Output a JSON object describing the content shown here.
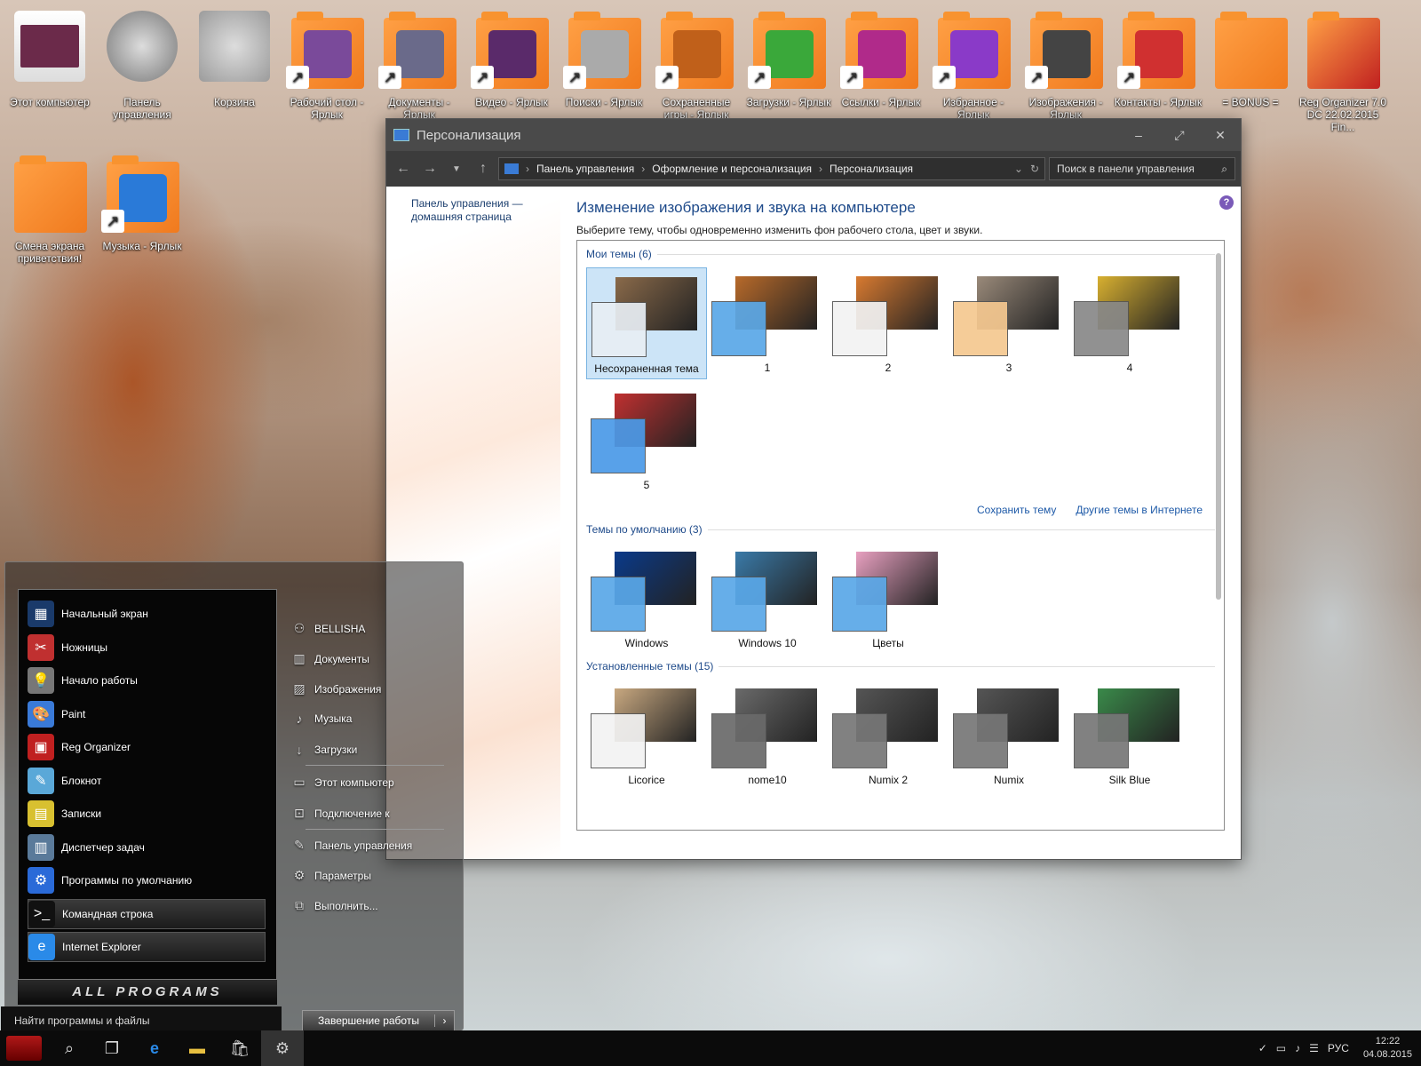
{
  "desktop_icons": [
    {
      "label": "Этот компьютер",
      "icon": "computer-icon",
      "color": "#6b2a4a"
    },
    {
      "label": "Панель управления",
      "icon": "gear-icon",
      "color": "#777777"
    },
    {
      "label": "Корзина",
      "icon": "recycle-bin-icon",
      "color": "#9b9b9b"
    },
    {
      "label": "Рабочий стол - Ярлык",
      "icon": "desktop-folder-icon",
      "color": "#7a4a9a"
    },
    {
      "label": "Документы - Ярлык",
      "icon": "documents-folder-icon",
      "color": "#6a6a8a"
    },
    {
      "label": "Видео - Ярлык",
      "icon": "video-folder-icon",
      "color": "#5a2a6a"
    },
    {
      "label": "Поиски - Ярлык",
      "icon": "search-folder-icon",
      "color": "#aaaaaa"
    },
    {
      "label": "Сохраненные игры - Ярлык",
      "icon": "games-folder-icon",
      "color": "#c0601a"
    },
    {
      "label": "Загрузки - Ярлык",
      "icon": "downloads-folder-icon",
      "color": "#3aa83a"
    },
    {
      "label": "Ссылки - Ярлык",
      "icon": "links-folder-icon",
      "color": "#b02a8a"
    },
    {
      "label": "Избранное - Ярлык",
      "icon": "favorites-folder-icon",
      "color": "#8a3ac8"
    },
    {
      "label": "Изображения - Ярлык",
      "icon": "pictures-folder-icon",
      "color": "#444444"
    },
    {
      "label": "Контакты - Ярлык",
      "icon": "contacts-folder-icon",
      "color": "#d03030"
    },
    {
      "label": "= BONUS =",
      "icon": "folder-icon",
      "color": "#f07a1e"
    },
    {
      "label": "Reg Organizer 7.0 DC 22.02.2015 Fin...",
      "icon": "folder-icon",
      "color": "#c02020"
    },
    {
      "label": "Смена экрана приветствия!",
      "icon": "folder-icon",
      "color": "#f07a1e"
    },
    {
      "label": "Музыка - Ярлык",
      "icon": "music-folder-icon",
      "color": "#2a7ad8"
    }
  ],
  "window": {
    "title": "Персонализация",
    "minimize": "–",
    "maximize": "⤢",
    "close": "✕",
    "breadcrumb": [
      "Панель управления",
      "Оформление и персонализация",
      "Персонализация"
    ],
    "search_placeholder": "Поиск в панели управления",
    "side_link": "Панель управления — домашняя страница",
    "heading": "Изменение изображения и звука на компьютере",
    "subheading": "Выберите тему, чтобы одновременно изменить фон рабочего стола, цвет и звуки.",
    "sections": {
      "my_themes": "Мои темы (6)",
      "default_themes": "Темы по умолчанию (3)",
      "installed_themes": "Установленные темы (15)"
    },
    "my_themes": [
      {
        "name": "Несохраненная тема",
        "bg": "#8a6a4a",
        "swatch": "#e8eef4",
        "selected": true
      },
      {
        "name": "1",
        "bg": "#b86a2a",
        "swatch": "#5aa8e8"
      },
      {
        "name": "2",
        "bg": "#d87a30",
        "swatch": "#f2f2f2"
      },
      {
        "name": "3",
        "bg": "#9a8a7a",
        "swatch": "#f5c890"
      },
      {
        "name": "4",
        "bg": "#d8b030",
        "swatch": "#888888"
      },
      {
        "name": "5",
        "bg": "#c03030",
        "swatch": "#4a9ae8"
      }
    ],
    "save_theme": "Сохранить тему",
    "more_themes": "Другие темы в Интернете",
    "default_themes": [
      {
        "name": "Windows",
        "bg": "#0a3a8a",
        "swatch": "#5aa8e8"
      },
      {
        "name": "Windows 10",
        "bg": "#3a7aa8",
        "swatch": "#5aa8e8"
      },
      {
        "name": "Цветы",
        "bg": "#e8a0c0",
        "swatch": "#5aa8e8"
      }
    ],
    "installed_themes": [
      {
        "name": "Licorice",
        "bg": "#c8a880",
        "swatch": "#f2f2f2"
      },
      {
        "name": "nome10",
        "bg": "#6a6a6a",
        "swatch": "#6a6a6a"
      },
      {
        "name": "Numix 2",
        "bg": "#555555",
        "swatch": "#777777"
      },
      {
        "name": "Numix",
        "bg": "#555555",
        "swatch": "#777777"
      },
      {
        "name": "Silk Blue",
        "bg": "#3a8a4a",
        "swatch": "#777777"
      }
    ]
  },
  "start_menu": {
    "left_items": [
      "Начальный экран",
      "Ножницы",
      "Начало работы",
      "Paint",
      "Reg Organizer",
      "Блокнот",
      "Записки",
      "Диспетчер задач",
      "Программы по умолчанию",
      "Командная строка",
      "Internet Explorer"
    ],
    "all_programs": "ALL PROGRAMS",
    "search_placeholder": "Найти программы и файлы",
    "right_items": [
      "BELLISHA",
      "Документы",
      "Изображения",
      "Музыка",
      "Загрузки",
      "Этот компьютер",
      "Подключение к",
      "Панель управления",
      "Параметры",
      "Выполнить..."
    ],
    "shutdown": "Завершение работы",
    "shutdown_arrow": "›"
  },
  "taskbar": {
    "language": "РУС",
    "time": "12:22",
    "date": "04.08.2015"
  }
}
